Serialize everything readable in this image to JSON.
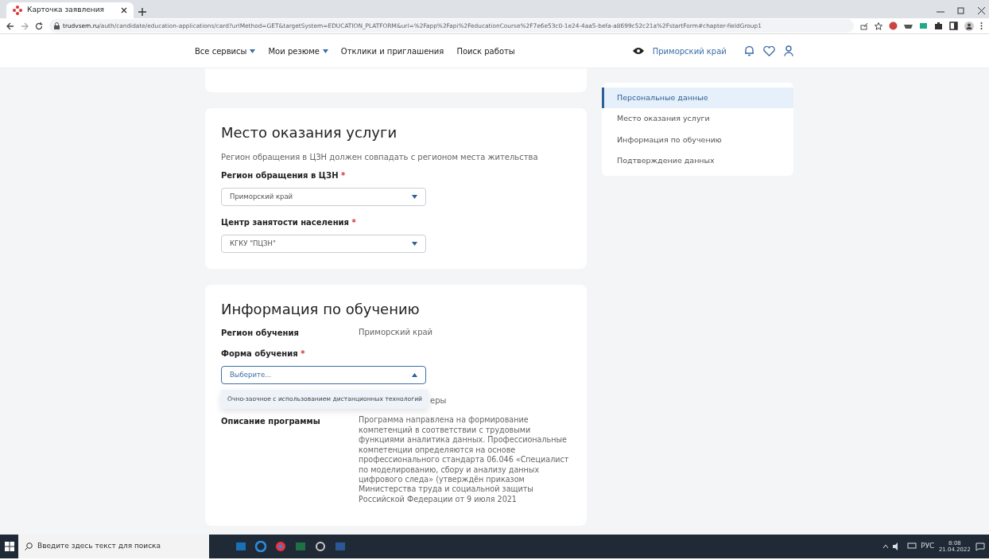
{
  "browser": {
    "tab_title": "Карточка заявления",
    "url_host": "trudvsem.ru",
    "url_path": "/auth/candidate/education-applications/card?urlMethod=GET&targetSystem=EDUCATION_PLATFORM&url=%2Fapp%2Fapi%2FeducationCourse%2F7e6e53c0-1e24-4aa5-befa-a8699c52c21a%2FstartForm#chapter-fieldGroup1"
  },
  "header": {
    "menu": [
      {
        "label": "Все сервисы",
        "has_caret": true
      },
      {
        "label": "Мои резюме",
        "has_caret": true
      },
      {
        "label": "Отклики и приглашения",
        "has_caret": false
      },
      {
        "label": "Поиск работы",
        "has_caret": false
      }
    ],
    "region": "Приморский край"
  },
  "service_place": {
    "title": "Место оказания услуги",
    "hint": "Регион обращения в ЦЗН должен совпадать с регионом места жительства",
    "fields": [
      {
        "label": "Регион обращения в ЦЗН",
        "required_mark": "*",
        "value": "Приморский край"
      },
      {
        "label": "Центр занятости населения",
        "required_mark": "*",
        "value": "КГКУ \"ПЦЗН\""
      }
    ]
  },
  "education": {
    "title": "Информация по обучению",
    "region_label": "Регион обучения",
    "region_value": "Приморский край",
    "form_field": {
      "label": "Форма обучения",
      "required_mark": "*",
      "placeholder": "Выберите...",
      "expanded": true,
      "options": [
        {
          "label": "Очно-заочное с использованием дистанционных технологий",
          "selected": false
        }
      ]
    },
    "hidden_row_tail": "еры",
    "description_label": "Описание программы",
    "description": "Программа направлена на формирование компетенций в соответствии с трудовыми функциями аналитика данных. Профессиональные компетенции определяются на основе профессионального стандарта 06.046 «Специалист по моделированию, сбору и анализу данных цифрового следа» (утверждён приказом Министерства труда и социальной защиты Российской Федерации от 9 июля 2021"
  },
  "sidebar": {
    "items": [
      {
        "label": "Персональные данные",
        "selected": true
      },
      {
        "label": "Место оказания услуги",
        "selected": false
      },
      {
        "label": "Информация по обучению",
        "selected": false
      },
      {
        "label": "Подтверждение данных",
        "selected": false
      }
    ]
  },
  "taskbar": {
    "search_placeholder": "Введите здесь текст для поиска",
    "language": "РУС",
    "time": "8:08",
    "date": "21.04.2022"
  }
}
